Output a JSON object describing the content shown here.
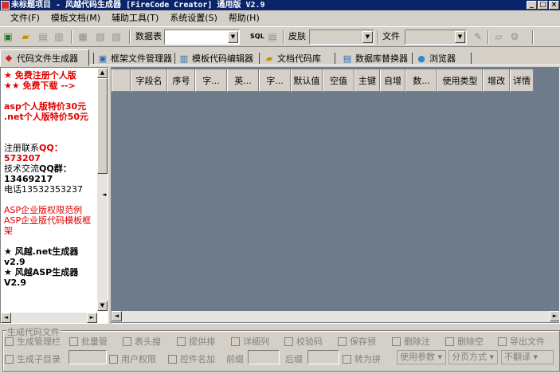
{
  "window": {
    "title": "未标题项目 - 风越代码生成器 [FireCode Creator] 通用版 V2.9"
  },
  "menu": [
    "文件(F)",
    "模板文档(M)",
    "辅助工具(T)",
    "系统设置(S)",
    "帮助(H)"
  ],
  "toolbar": {
    "datatable_label": "数据表",
    "sql_label": "SQL",
    "skin_label": "皮肤",
    "file_label": "文件"
  },
  "tabs": [
    "代码文件生成器",
    "框架文件管理器",
    "模板代码编辑器",
    "文档代码库",
    "数据库替换器",
    "浏览器"
  ],
  "left_panel": {
    "promo1": "★ 免费注册个人版",
    "promo2": "★★ 免费下载 -->",
    "price1": "asp个人版特价30元",
    "price2": ".net个人版特价50元",
    "contact_label": "注册联系",
    "qq_label": "QQ：",
    "qq": "573207",
    "group_label_a": "技术交流",
    "group_label_b": "QQ群：",
    "group": "13469217",
    "phone": "电话13532353237",
    "link1": "ASP企业版权限范例",
    "link2": "ASP企业版代码模板框架",
    "product1": "★ 风越.net生成器",
    "product1_ver": "v2.9",
    "product2": "★ 风越ASP生成器",
    "product2_ver": "V2.9"
  },
  "grid": {
    "columns": [
      "",
      "字段名",
      "序号",
      "字...",
      "英...",
      "字...",
      "默认值",
      "空值",
      "主键",
      "自增",
      "数...",
      "使用类型",
      "增改",
      "详情"
    ]
  },
  "generate": {
    "legend": "生成代码文件",
    "row1": [
      "生成管理栏",
      "批量管",
      "表头搜",
      "提供排",
      "详细列",
      "校验码",
      "保存预",
      "删除注",
      "删除空",
      "导出文件"
    ],
    "row2_a": "生成子目录",
    "row2_b": "用户权限",
    "row2_c": "控件名加",
    "prefix_label": "前缀",
    "suffix_label": "后缀",
    "pinyin": "转为拼",
    "param_dd": "使用参数",
    "page_dd": "分页方式",
    "tree_dd": "不翻译"
  }
}
